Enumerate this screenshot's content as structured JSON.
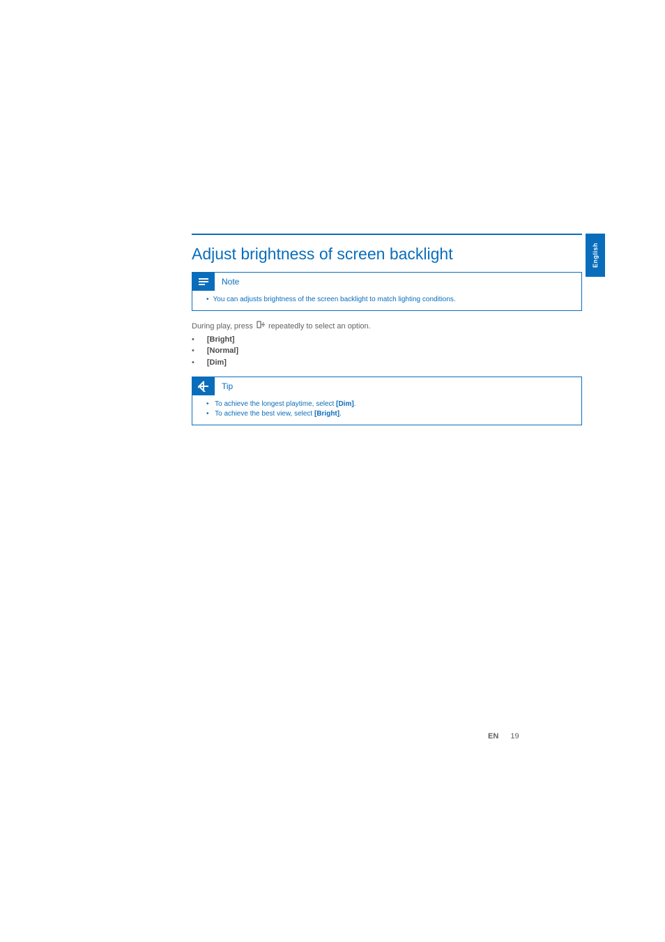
{
  "heading": "Adjust brightness of screen backlight",
  "language_tab": "English",
  "note": {
    "title": "Note",
    "items": [
      "You can adjusts brightness of the screen backlight to match lighting conditions."
    ]
  },
  "body": {
    "line_pre": "During play, press ",
    "line_post": " repeatedly to select an option.",
    "options": [
      "[Bright]",
      "[Normal]",
      "[Dim]"
    ]
  },
  "tip": {
    "title": "Tip",
    "items": [
      {
        "pre": "To achieve the longest playtime, select ",
        "bold": "[Dim]",
        "post": "."
      },
      {
        "pre": "To achieve the best view, select ",
        "bold": "[Bright]",
        "post": "."
      }
    ]
  },
  "footer": {
    "lang": "EN",
    "page": "19"
  }
}
